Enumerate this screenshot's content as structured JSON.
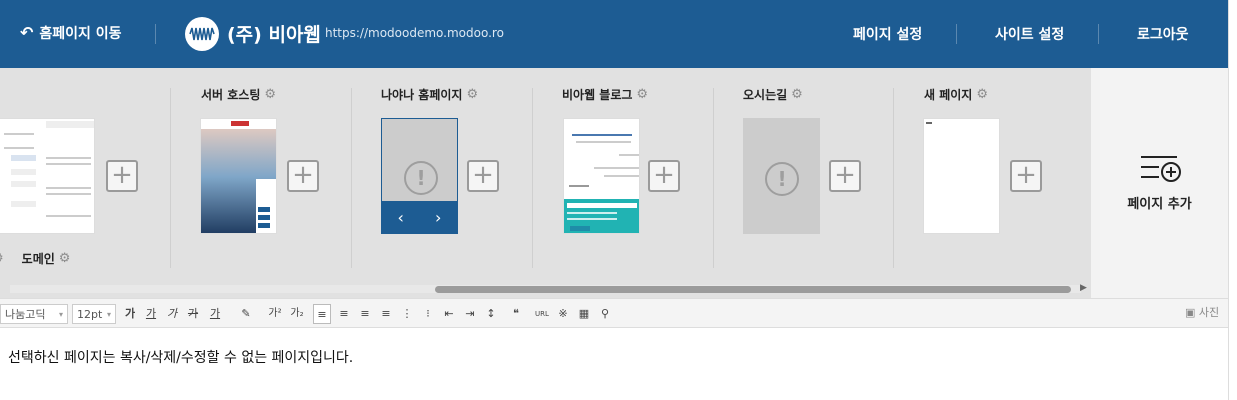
{
  "header": {
    "back_label": "홈페이지 이동",
    "company": "(주) 비아웹",
    "url": "https://modoodemo.modoo.ro",
    "links": [
      "페이지 설정",
      "사이트 설정",
      "로그아웃"
    ]
  },
  "pages": [
    {
      "title": "도메인",
      "state": "thumbnail"
    },
    {
      "title": "서버 호스팅",
      "state": "thumbnail"
    },
    {
      "title": "나야나 홈페이지",
      "state": "selected-empty"
    },
    {
      "title": "비아웹 블로그",
      "state": "thumbnail"
    },
    {
      "title": "오시는길",
      "state": "empty"
    },
    {
      "title": "새 페이지",
      "state": "blank"
    }
  ],
  "add_page_label": "페이지 추가",
  "editor": {
    "font": "나눔고딕",
    "size": "12pt",
    "photo_label": "사진",
    "url_button": "URL",
    "message": "선택하신 페이지는 복사/삭제/수정할 수 없는 페이지입니다."
  },
  "colors": {
    "header": "#1d5c93",
    "pagebar": "#e1e1e1"
  }
}
